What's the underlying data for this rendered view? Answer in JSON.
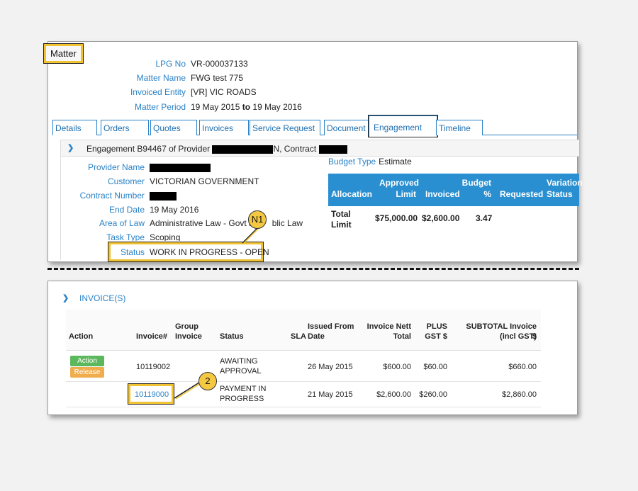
{
  "matter": {
    "title": "Matter",
    "lpg_no_label": "LPG No",
    "lpg_no": "VR-000037133",
    "matter_name_label": "Matter Name",
    "matter_name": "FWG test 775",
    "invoiced_entity_label": "Invoiced Entity",
    "invoiced_entity": "[VR] VIC ROADS",
    "matter_period_label": "Matter Period",
    "period_from": "19 May 2015",
    "period_to_word": "to",
    "period_to": "19 May 2016"
  },
  "tabs": [
    "Details",
    "Orders",
    "Quotes",
    "Invoices",
    "Service Request",
    "Document",
    "Engagement",
    "Timeline"
  ],
  "engagement": {
    "header_prefix": "Engagement B94467 of Provider",
    "header_mid": "N, Contract",
    "provider_name_label": "Provider Name",
    "customer_label": "Customer",
    "customer": "VICTORIAN GOVERNMENT",
    "contract_number_label": "Contract Number",
    "end_date_label": "End Date",
    "end_date": "19 May 2016",
    "area_of_law_label": "Area of Law",
    "area_of_law_a": "Administrative Law - Govt a",
    "area_of_law_b": "blic Law",
    "task_type_label": "Task Type",
    "task_type": "Scoping",
    "status_label": "Status",
    "status": "WORK IN PROGRESS - OPEN",
    "budget_type_label": "Budget Type",
    "budget_type": "Estimate"
  },
  "budget_table": {
    "headers": {
      "allocation": "Allocation",
      "approved_1": "Approved",
      "approved_2": "Limit",
      "invoiced": "Invoiced",
      "budget_1": "Budget",
      "budget_2": "%",
      "requested": "Requested",
      "variation_1": "Variation",
      "variation_2": "Status"
    },
    "row": {
      "allocation_1": "Total",
      "allocation_2": "Limit",
      "approved": "$75,000.00",
      "invoiced": "$2,600.00",
      "budget_pct": "3.47"
    }
  },
  "annotations": {
    "n1": "N1",
    "n2": "2"
  },
  "invoices": {
    "section_title": "INVOICE(S)",
    "headers": {
      "action": "Action",
      "invoice_no": "Invoice#",
      "group_1": "Group",
      "group_2": "Invoice",
      "status": "Status",
      "sla": "SLA",
      "issued_1": "Issued From",
      "issued_2": "Date",
      "nett_1": "Invoice Nett",
      "nett_2": "Total",
      "gst_1": "PLUS",
      "gst_2": "GST $",
      "subtotal_1": "SUBTOTAL Invoice $",
      "subtotal_2": "(incl GST)"
    },
    "rows": [
      {
        "action_label": "Action",
        "release_label": "Release",
        "invoice_no": "10119002",
        "status_1": "AWAITING",
        "status_2": "APPROVAL",
        "issued": "26 May 2015",
        "nett": "$600.00",
        "gst": "$60.00",
        "subtotal": "$660.00"
      },
      {
        "invoice_no": "10119000",
        "status_1": "PAYMENT IN",
        "status_2": "PROGRESS",
        "issued": "21 May 2015",
        "nett": "$2,600.00",
        "gst": "$260.00",
        "subtotal": "$2,860.00"
      }
    ]
  },
  "colors": {
    "accent": "#2a82c7",
    "highlight": "#f1c232",
    "table_header": "#2a8fd0"
  }
}
